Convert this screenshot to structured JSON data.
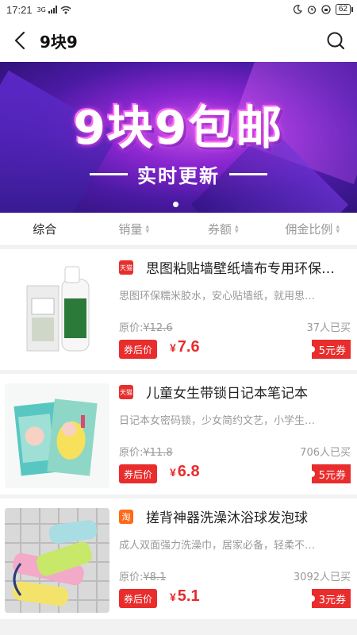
{
  "status": {
    "time": "17:21",
    "network": "3G",
    "battery": "62"
  },
  "nav": {
    "title": "9块9"
  },
  "banner": {
    "headline": "9块9包邮",
    "subline": "实时更新"
  },
  "sort": [
    {
      "label": "综合"
    },
    {
      "label": "销量"
    },
    {
      "label": "券额"
    },
    {
      "label": "佣金比例"
    }
  ],
  "products": [
    {
      "platform": "天猫",
      "title": "思图粘贴墙壁纸墙布专用环保…",
      "desc": "思图环保糯米胶水，安心贴墙纸，就用思…",
      "orig_label": "原价:",
      "orig_price": "¥12.6",
      "sold": "37人已买",
      "coupon_tag": "券后价",
      "yen": "¥",
      "price": "7.6",
      "coupon": "5元券"
    },
    {
      "platform": "天猫",
      "title": "儿童女生带锁日记本笔记本",
      "desc": "日记本女密码锁，少女简约文艺，小学生…",
      "orig_label": "原价:",
      "orig_price": "¥11.8",
      "sold": "706人已买",
      "coupon_tag": "券后价",
      "yen": "¥",
      "price": "6.8",
      "coupon": "5元券"
    },
    {
      "platform": "淘",
      "title": "搓背神器洗澡沐浴球发泡球",
      "desc": "成人双面强力洗澡巾，居家必备，轻柔不…",
      "orig_label": "原价:",
      "orig_price": "¥8.1",
      "sold": "3092人已买",
      "coupon_tag": "券后价",
      "yen": "¥",
      "price": "5.1",
      "coupon": "3元券"
    }
  ],
  "colors": {
    "accent": "#e92c2c",
    "tmall": "#e62e2e",
    "taobao": "#ff6a1a"
  }
}
